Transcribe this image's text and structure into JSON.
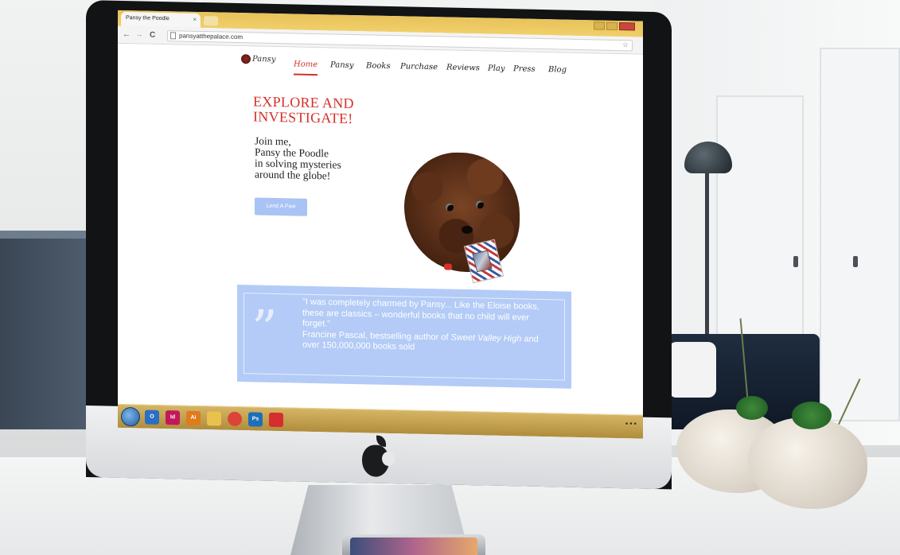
{
  "browser": {
    "tab_title": "Pansy the Poodle",
    "tab_close": "×",
    "url": "pansyatthepalace.com",
    "nav_back": "←",
    "nav_forward": "→",
    "nav_reload": "C",
    "bookmark_star": "☆"
  },
  "site": {
    "logo_text": "Pansy",
    "nav": [
      {
        "label": "Home",
        "active": true
      },
      {
        "label": "Pansy"
      },
      {
        "label": "Books"
      },
      {
        "label": "Purchase"
      },
      {
        "label": "Reviews"
      },
      {
        "label": "Play"
      },
      {
        "label": "Press"
      },
      {
        "label": "Blog"
      }
    ],
    "hero": {
      "title_line1": "EXPLORE AND",
      "title_line2": "INVESTIGATE!",
      "sub_lines": [
        "Join me,",
        "Pansy the Poodle",
        "in solving mysteries",
        "around the globe!"
      ],
      "cta_label": "Lend A Paw"
    },
    "testimonial": {
      "mark": "”",
      "quote": "\"I was completely charmed by Pansy... Like the Eloise books, these are classics – wonderful books that no child will ever forget.\"",
      "attribution_prefix": "Francine Pascal, bestselling author of ",
      "attribution_title": "Sweet Valley High",
      "attribution_suffix": " and over 150,000,000 books sold"
    }
  },
  "taskbar": {
    "apps": [
      {
        "name": "outlook-icon",
        "label": "O",
        "color": "#2a6fc4"
      },
      {
        "name": "indesign-icon",
        "label": "Id",
        "color": "#c2185b"
      },
      {
        "name": "illustrator-icon",
        "label": "Ai",
        "color": "#e07b1c"
      },
      {
        "name": "explorer-icon",
        "label": "",
        "color": "#e8c24c"
      },
      {
        "name": "chrome-icon",
        "label": "",
        "color": "#db4437"
      },
      {
        "name": "photoshop-icon",
        "label": "Ps",
        "color": "#1c6fb8"
      },
      {
        "name": "acrobat-icon",
        "label": "",
        "color": "#d62e2e"
      }
    ]
  },
  "colors": {
    "accent_red": "#d4312a",
    "testimonial_bg": "#b3cbf6",
    "cta_bg": "#a9c3f5"
  }
}
